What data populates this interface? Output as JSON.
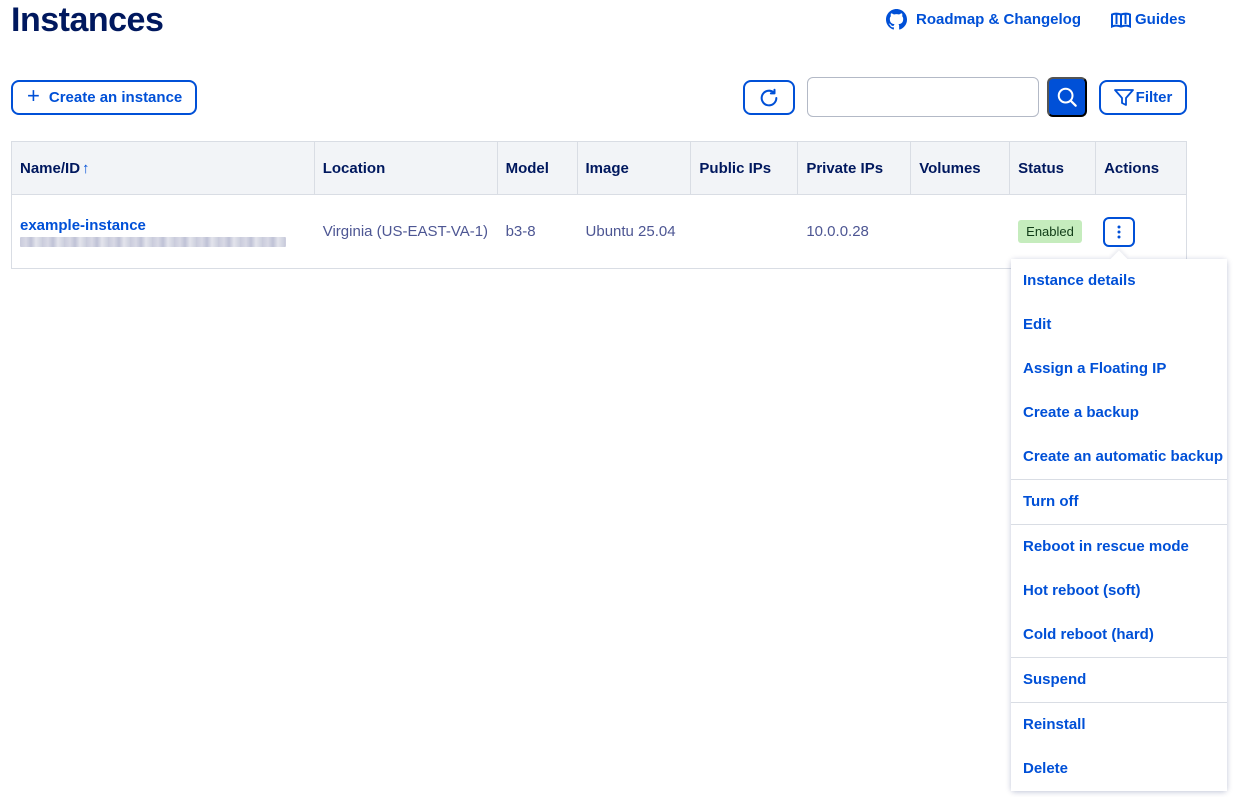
{
  "header": {
    "title": "Instances",
    "roadmap_label": "Roadmap & Changelog",
    "guides_label": "Guides"
  },
  "toolbar": {
    "create_label": "Create an instance",
    "search_placeholder": "",
    "filter_label": "Filter"
  },
  "table": {
    "columns": [
      "Name/ID",
      "Location",
      "Model",
      "Image",
      "Public IPs",
      "Private IPs",
      "Volumes",
      "Status",
      "Actions"
    ],
    "sort_indicator": "↑",
    "rows": [
      {
        "name": "example-instance",
        "location": "Virginia (US-EAST-VA-1)",
        "model": "b3-8",
        "image": "Ubuntu 25.04",
        "public_ips": "",
        "private_ips": "10.0.0.28",
        "volumes": "",
        "status": "Enabled"
      }
    ]
  },
  "action_menu": {
    "items": [
      "Instance details",
      "Edit",
      "Assign a Floating IP",
      "Create a backup",
      "Create an automatic backup",
      "Turn off",
      "Reboot in rescue mode",
      "Hot reboot (soft)",
      "Cold reboot (hard)",
      "Suspend",
      "Reinstall",
      "Delete"
    ]
  },
  "colors": {
    "primary": "#0050d7",
    "title": "#00185e",
    "status_enabled_bg": "#c5ecbd"
  }
}
